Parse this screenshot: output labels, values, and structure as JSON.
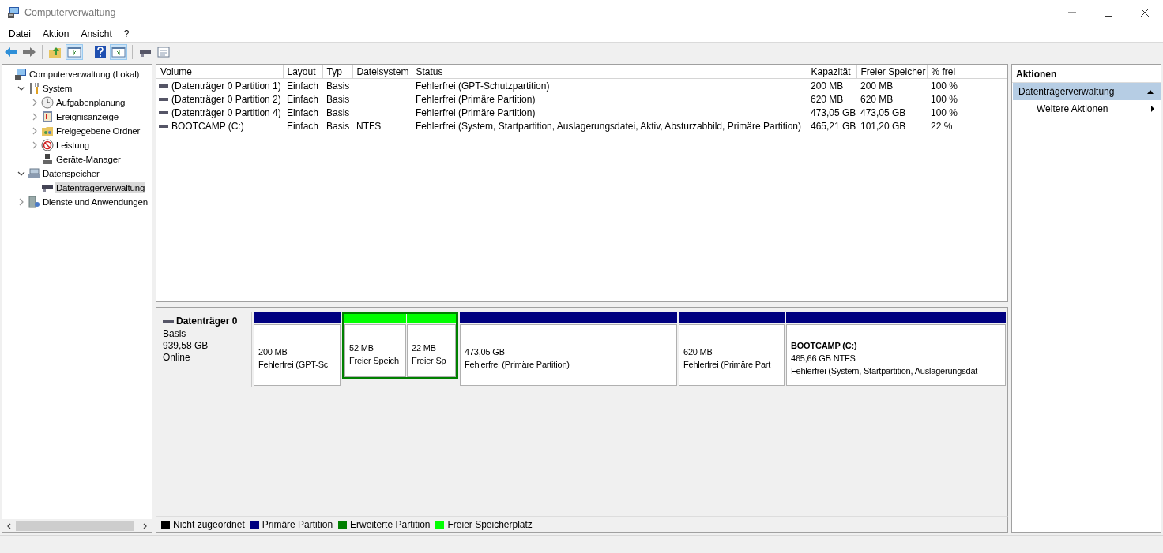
{
  "window": {
    "title": "Computerverwaltung"
  },
  "menu": [
    "Datei",
    "Aktion",
    "Ansicht",
    "?"
  ],
  "tree": [
    {
      "label": "Computerverwaltung (Lokal)",
      "kind": "computer",
      "selected": false,
      "children": [
        {
          "label": "System",
          "kind": "tools",
          "selected": false,
          "expanded": true,
          "children": [
            {
              "label": "Aufgabenplanung",
              "kind": "clock",
              "selected": false,
              "expanded": false
            },
            {
              "label": "Ereignisanzeige",
              "kind": "log",
              "selected": false,
              "expanded": false
            },
            {
              "label": "Freigegebene Ordner",
              "kind": "folder",
              "selected": false,
              "expanded": false
            },
            {
              "label": "Leistung",
              "kind": "gauge",
              "selected": false,
              "expanded": false
            },
            {
              "label": "Geräte-Manager",
              "kind": "device",
              "selected": false
            }
          ]
        },
        {
          "label": "Datenspeicher",
          "kind": "storage",
          "selected": false,
          "expanded": true,
          "children": [
            {
              "label": "Datenträgerverwaltung",
              "kind": "disk",
              "selected": true
            }
          ]
        },
        {
          "label": "Dienste und Anwendungen",
          "kind": "services",
          "selected": false,
          "expanded": false
        }
      ]
    }
  ],
  "table": {
    "columns": [
      "Volume",
      "Layout",
      "Typ",
      "Dateisystem",
      "Status",
      "Kapazität",
      "Freier Speicher",
      "% frei"
    ],
    "rows": [
      [
        "(Datenträger 0 Partition 1)",
        "Einfach",
        "Basis",
        "",
        "Fehlerfrei (GPT-Schutzpartition)",
        "200 MB",
        "200 MB",
        "100 %"
      ],
      [
        "(Datenträger 0 Partition 2)",
        "Einfach",
        "Basis",
        "",
        "Fehlerfrei (Primäre Partition)",
        "620 MB",
        "620 MB",
        "100 %"
      ],
      [
        "(Datenträger 0 Partition 4)",
        "Einfach",
        "Basis",
        "",
        "Fehlerfrei (Primäre Partition)",
        "473,05 GB",
        "473,05 GB",
        "100 %"
      ],
      [
        "BOOTCAMP (C:)",
        "Einfach",
        "Basis",
        "NTFS",
        "Fehlerfrei (System, Startpartition, Auslagerungsdatei, Aktiv, Absturzabbild, Primäre Partition)",
        "465,21 GB",
        "101,20 GB",
        "22 %"
      ]
    ]
  },
  "disk": {
    "name": "Datenträger 0",
    "type": "Basis",
    "size": "939,58 GB",
    "state": "Online",
    "partitions": [
      {
        "kind": "primary",
        "lines": [
          "200 MB",
          "Fehlerfrei (GPT-Sc"
        ]
      },
      {
        "kind": "extended",
        "children": [
          {
            "kind": "free",
            "lines": [
              "52 MB",
              "Freier Speich"
            ]
          },
          {
            "kind": "free",
            "lines": [
              "22 MB",
              "Freier Sp"
            ]
          }
        ]
      },
      {
        "kind": "primary",
        "lines": [
          "473,05 GB",
          "Fehlerfrei (Primäre Partition)"
        ]
      },
      {
        "kind": "primary",
        "lines": [
          "620 MB",
          "Fehlerfrei (Primäre Part"
        ]
      },
      {
        "kind": "primary",
        "name": "BOOTCAMP  (C:)",
        "lines": [
          "465,66 GB NTFS",
          "Fehlerfrei (System, Startpartition, Auslagerungsdat"
        ]
      }
    ]
  },
  "legend": [
    {
      "label": "Nicht zugeordnet",
      "color": "#000000"
    },
    {
      "label": "Primäre Partition",
      "color": "#000080"
    },
    {
      "label": "Erweiterte Partition",
      "color": "#008000"
    },
    {
      "label": "Freier Speicherplatz",
      "color": "#00ff00"
    }
  ],
  "actions": {
    "title": "Aktionen",
    "sections": [
      {
        "label": "Datenträgerverwaltung",
        "expanded": true,
        "items": [
          "Weitere Aktionen"
        ]
      }
    ]
  }
}
